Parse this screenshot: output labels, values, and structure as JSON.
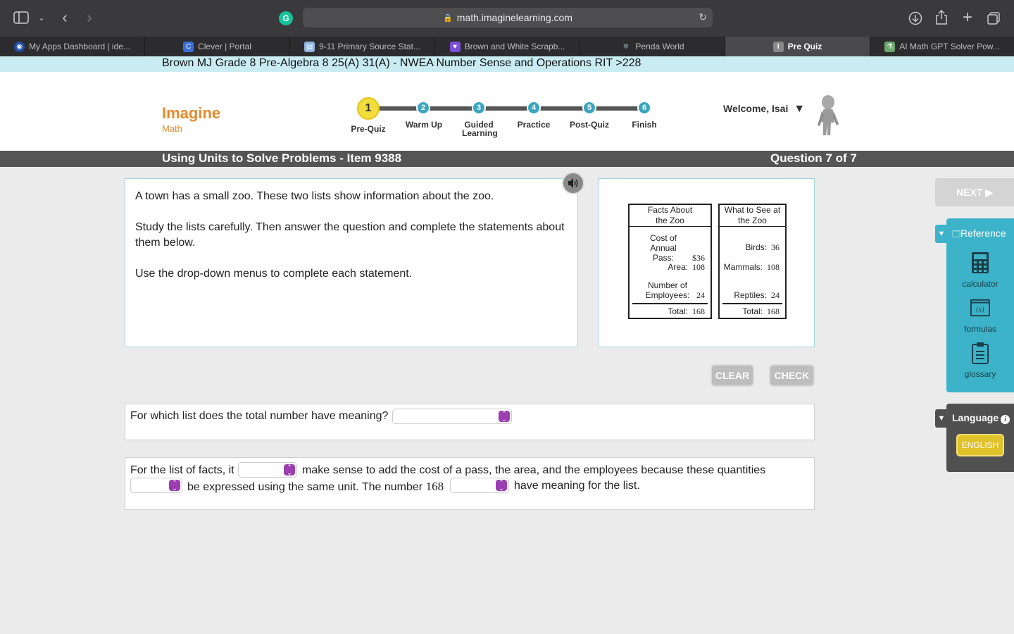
{
  "browser": {
    "url": "math.imaginelearning.com",
    "tabs": [
      {
        "label": "My Apps Dashboard | ide...",
        "icon": "clever-dashboard-icon",
        "color": "#1f4ea8"
      },
      {
        "label": "Clever | Portal",
        "icon": "clever-icon",
        "color": "#3b6fd8"
      },
      {
        "label": "9-11 Primary Source Stat...",
        "icon": "doc-icon",
        "color": "#8fb5e0"
      },
      {
        "label": "Brown and White Scrapb...",
        "icon": "heart-icon",
        "color": "#7a4fd6"
      },
      {
        "label": "Penda World",
        "icon": "penda-icon",
        "color": "#555"
      },
      {
        "label": "Pre Quiz",
        "icon": "imagine-icon",
        "color": "#888"
      },
      {
        "label": "AI Math GPT Solver Pow...",
        "icon": "ai-math-icon",
        "color": "#6aa86a"
      }
    ],
    "active_tab": 5
  },
  "course": {
    "title": "Brown MJ Grade 8 Pre-Algebra 8 25(A) 31(A) - NWEA Number Sense and Operations RIT >228"
  },
  "header": {
    "logo_line1": "Imagine",
    "logo_line2": "Math",
    "welcome": "Welcome, Isai",
    "steps": [
      {
        "num": "1",
        "label": "Pre-Quiz"
      },
      {
        "num": "2",
        "label": "Warm Up"
      },
      {
        "num": "3",
        "label": "Guided Learning"
      },
      {
        "num": "4",
        "label": "Practice"
      },
      {
        "num": "5",
        "label": "Post-Quiz"
      },
      {
        "num": "6",
        "label": "Finish"
      }
    ]
  },
  "lesson": {
    "title": "Using Units to Solve Problems - Item 9388",
    "question_count": "Question 7 of 7"
  },
  "prompt": {
    "p1": "A town has a small zoo. These two lists show information about the zoo.",
    "p2": "Study the lists carefully. Then answer the question and complete the statements about them below.",
    "p3": "Use the drop-down menus to complete each statement."
  },
  "figure": {
    "facts": {
      "heading": "Facts About the Zoo",
      "rows": [
        {
          "label": "Cost of Annual Pass:",
          "value": "$36"
        },
        {
          "label": "Area:",
          "value": "108"
        },
        {
          "label": "Number of Employees:",
          "value": "24"
        }
      ],
      "total_label": "Total:",
      "total_value": "168"
    },
    "see": {
      "heading": "What to See at the Zoo",
      "rows": [
        {
          "label": "Birds:",
          "value": "36"
        },
        {
          "label": "Mammals:",
          "value": "108"
        },
        {
          "label": "Reptiles:",
          "value": "24"
        }
      ],
      "total_label": "Total:",
      "total_value": "168"
    }
  },
  "buttons": {
    "clear": "CLEAR",
    "check": "CHECK",
    "next": "NEXT ▶"
  },
  "questions": {
    "q1_text": "For which list does the total number have meaning?",
    "q2_part1": "For the list of facts, it",
    "q2_part2": "make sense to add the cost of a pass, the area, and the employees because these quantities",
    "q2_part3": "be expressed using the same unit. The number",
    "q2_number": "168",
    "q2_part4": "have meaning for the list."
  },
  "reference": {
    "title": "Reference",
    "tools": [
      "calculator",
      "formulas",
      "glossary"
    ]
  },
  "language": {
    "title": "Language",
    "button": "ENGLISH"
  }
}
